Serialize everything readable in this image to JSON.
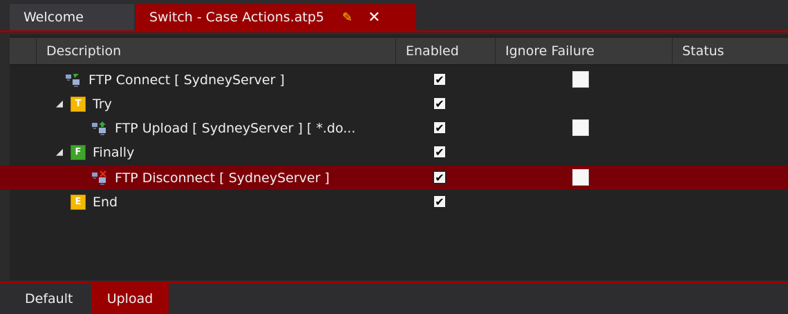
{
  "tabs": {
    "welcome_label": "Welcome",
    "active_label": "Switch - Case Actions.atp5",
    "edit_glyph": "✎",
    "close_glyph": "✕"
  },
  "columns": {
    "description": "Description",
    "enabled": "Enabled",
    "ignore_failure": "Ignore Failure",
    "status": "Status"
  },
  "rows": [
    {
      "label": "FTP Connect [ SydneyServer ]",
      "icon": "ftp-connect-icon",
      "enabled": true,
      "ignore_failure": false,
      "show_ignore": true,
      "selected": false
    },
    {
      "label": "Try",
      "icon": "try-block-icon",
      "badge": "T",
      "expander": "◢",
      "enabled": true,
      "show_ignore": false,
      "selected": false
    },
    {
      "label": "FTP Upload [ SydneyServer ] [ *.do...",
      "icon": "ftp-upload-icon",
      "enabled": true,
      "ignore_failure": false,
      "show_ignore": true,
      "selected": false
    },
    {
      "label": "Finally",
      "icon": "finally-block-icon",
      "badge": "F",
      "expander": "◢",
      "enabled": true,
      "show_ignore": false,
      "selected": false
    },
    {
      "label": "FTP Disconnect [ SydneyServer ]",
      "icon": "ftp-disconnect-icon",
      "enabled": true,
      "ignore_failure": false,
      "show_ignore": true,
      "selected": true
    },
    {
      "label": "End",
      "icon": "end-block-icon",
      "badge": "E",
      "enabled": true,
      "show_ignore": false,
      "selected": false
    }
  ],
  "bottom_tabs": {
    "default_label": "Default",
    "upload_label": "Upload"
  },
  "colors": {
    "accent": "#9b0000",
    "selected_row": "#7a0007",
    "try_badge": "#f5b800",
    "finally_badge": "#3fa52a"
  }
}
